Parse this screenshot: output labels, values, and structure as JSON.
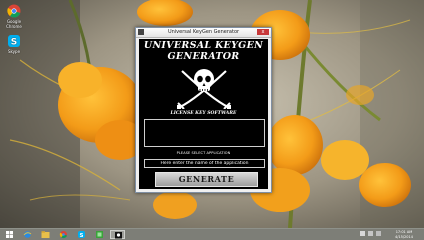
{
  "desktop": {
    "icons": [
      {
        "label": "Google Chrome",
        "icon": "chrome-icon"
      },
      {
        "label": "Skype",
        "icon": "skype-icon"
      }
    ]
  },
  "window": {
    "title": "Universal KeyGen Generator",
    "close_label": "x",
    "headline_line1": "UNIVERSAL KEYGEN",
    "headline_line2": "GENERATOR",
    "subtitle": "LICENSE KEY SOFTWARE",
    "hint": "PLEASE SELECT APPLICATION",
    "input_placeholder": "Here enter the name of the application",
    "generate_label": "GENERATE",
    "logo_icon": "skull-crossed-swords-icon"
  },
  "taskbar": {
    "items": [
      {
        "name": "start-button",
        "icon": "windows-logo-icon"
      },
      {
        "name": "taskbar-ie",
        "icon": "internet-explorer-icon"
      },
      {
        "name": "taskbar-explorer",
        "icon": "folder-icon"
      },
      {
        "name": "taskbar-chrome",
        "icon": "chrome-icon"
      },
      {
        "name": "taskbar-skype",
        "icon": "skype-icon"
      },
      {
        "name": "taskbar-app",
        "icon": "green-app-icon"
      },
      {
        "name": "taskbar-keygen",
        "icon": "keygen-icon"
      }
    ],
    "clock_time": "17:01 AM",
    "clock_date": "4/15/2014"
  },
  "colors": {
    "accent_window": "#000000",
    "taskbar": "#7d8078",
    "close_button": "#c7393a"
  }
}
